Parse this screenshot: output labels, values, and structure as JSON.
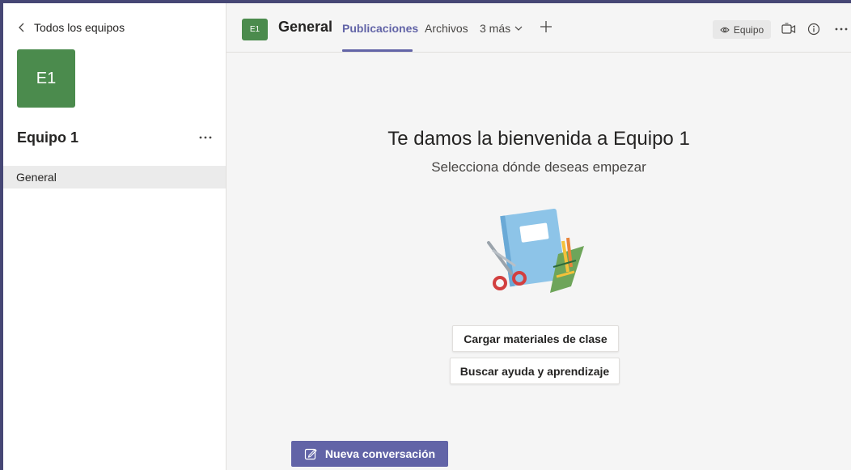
{
  "sidebar": {
    "back_label": "Todos los equipos",
    "team_initials": "E1",
    "team_name": "Equipo 1",
    "more_label": "···",
    "channels": [
      {
        "label": "General"
      }
    ]
  },
  "header": {
    "channel_initials": "E1",
    "channel_name": "General",
    "tabs": [
      {
        "label": "Publicaciones"
      },
      {
        "label": "Archivos"
      },
      {
        "label": "3 más"
      }
    ],
    "team_pill": "Equipo",
    "more_label": "···"
  },
  "welcome": {
    "title": "Te damos la bienvenida a Equipo 1",
    "subtitle": "Selecciona dónde deseas empezar",
    "buttons": [
      {
        "label": "Cargar materiales de clase"
      },
      {
        "label": "Buscar ayuda y aprendizaje"
      }
    ]
  },
  "compose": {
    "new_conversation_label": "Nueva conversación"
  },
  "colors": {
    "frame": "#464775",
    "accent": "#6264a7",
    "team_green": "#4b8b4d"
  },
  "icons": [
    "chevron-left-icon",
    "ellipsis-icon",
    "chevron-down-icon",
    "plus-icon",
    "eye-icon",
    "video-call-icon",
    "info-icon",
    "compose-icon"
  ]
}
